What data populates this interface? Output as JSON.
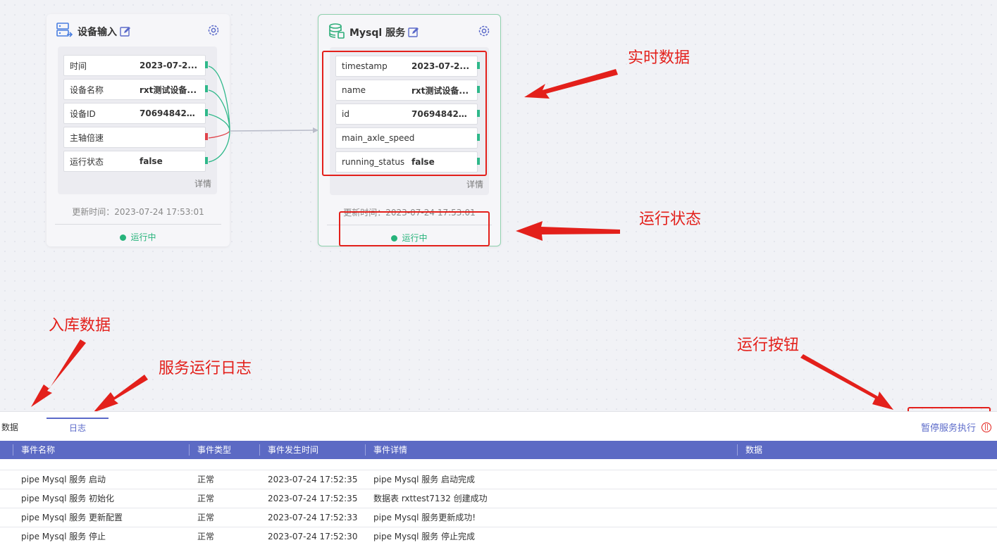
{
  "nodes": {
    "device": {
      "title": "设备输入",
      "fields": [
        {
          "key": "时间",
          "value": "2023-07-2...",
          "port": "green"
        },
        {
          "key": "设备名称",
          "value": "rxt测试设备...",
          "port": "green"
        },
        {
          "key": "设备ID",
          "value": "706948422...",
          "port": "green"
        },
        {
          "key": "主轴倍速",
          "value": "",
          "port": "red"
        },
        {
          "key": "运行状态",
          "value": "false",
          "port": "green"
        }
      ],
      "detail": "详情",
      "updated": "更新时间：2023-07-24 17:53:01",
      "status": "运行中",
      "icon": "device-input-icon"
    },
    "mysql": {
      "title": "Mysql 服务",
      "fields": [
        {
          "key": "timestamp",
          "value": "2023-07-2...",
          "port": "green"
        },
        {
          "key": "name",
          "value": "rxt测试设备...",
          "port": "green"
        },
        {
          "key": "id",
          "value": "706948422...",
          "port": "green"
        },
        {
          "key": "main_axle_speed",
          "value": "",
          "port": "green"
        },
        {
          "key": "running_status",
          "value": "false",
          "port": "green"
        }
      ],
      "detail": "详情",
      "updated": "更新时间：2023-07-24 17:53:01",
      "status": "运行中",
      "icon": "database-icon"
    }
  },
  "annotations": {
    "realtime": "实时数据",
    "run_status": "运行状态",
    "stored_data": "入库数据",
    "service_log": "服务运行日志",
    "run_button": "运行按钮"
  },
  "panel": {
    "tabs": {
      "data": "数据",
      "log": "日志"
    },
    "pause_button": "暂停服务执行",
    "columns": [
      "事件名称",
      "事件类型",
      "事件发生时间",
      "事件详情",
      "数据"
    ],
    "rows": [
      [
        "pipe Mysql 服务 启动",
        "正常",
        "2023-07-24 17:52:35",
        "pipe Mysql 服务 启动完成",
        ""
      ],
      [
        "pipe Mysql 服务 初始化",
        "正常",
        "2023-07-24 17:52:35",
        "数据表 rxttest7132 创建成功",
        ""
      ],
      [
        "pipe Mysql 服务 更新配置",
        "正常",
        "2023-07-24 17:52:33",
        "pipe Mysql 服务更新成功!",
        ""
      ],
      [
        "pipe Mysql 服务 停止",
        "正常",
        "2023-07-24 17:52:30",
        "pipe Mysql 服务 停止完成",
        ""
      ]
    ]
  },
  "colors": {
    "accent": "#5c6ac4",
    "running": "#27b37b",
    "annotation": "#e3201b",
    "port_ok": "#2fb88a",
    "port_error": "#e0434a"
  }
}
